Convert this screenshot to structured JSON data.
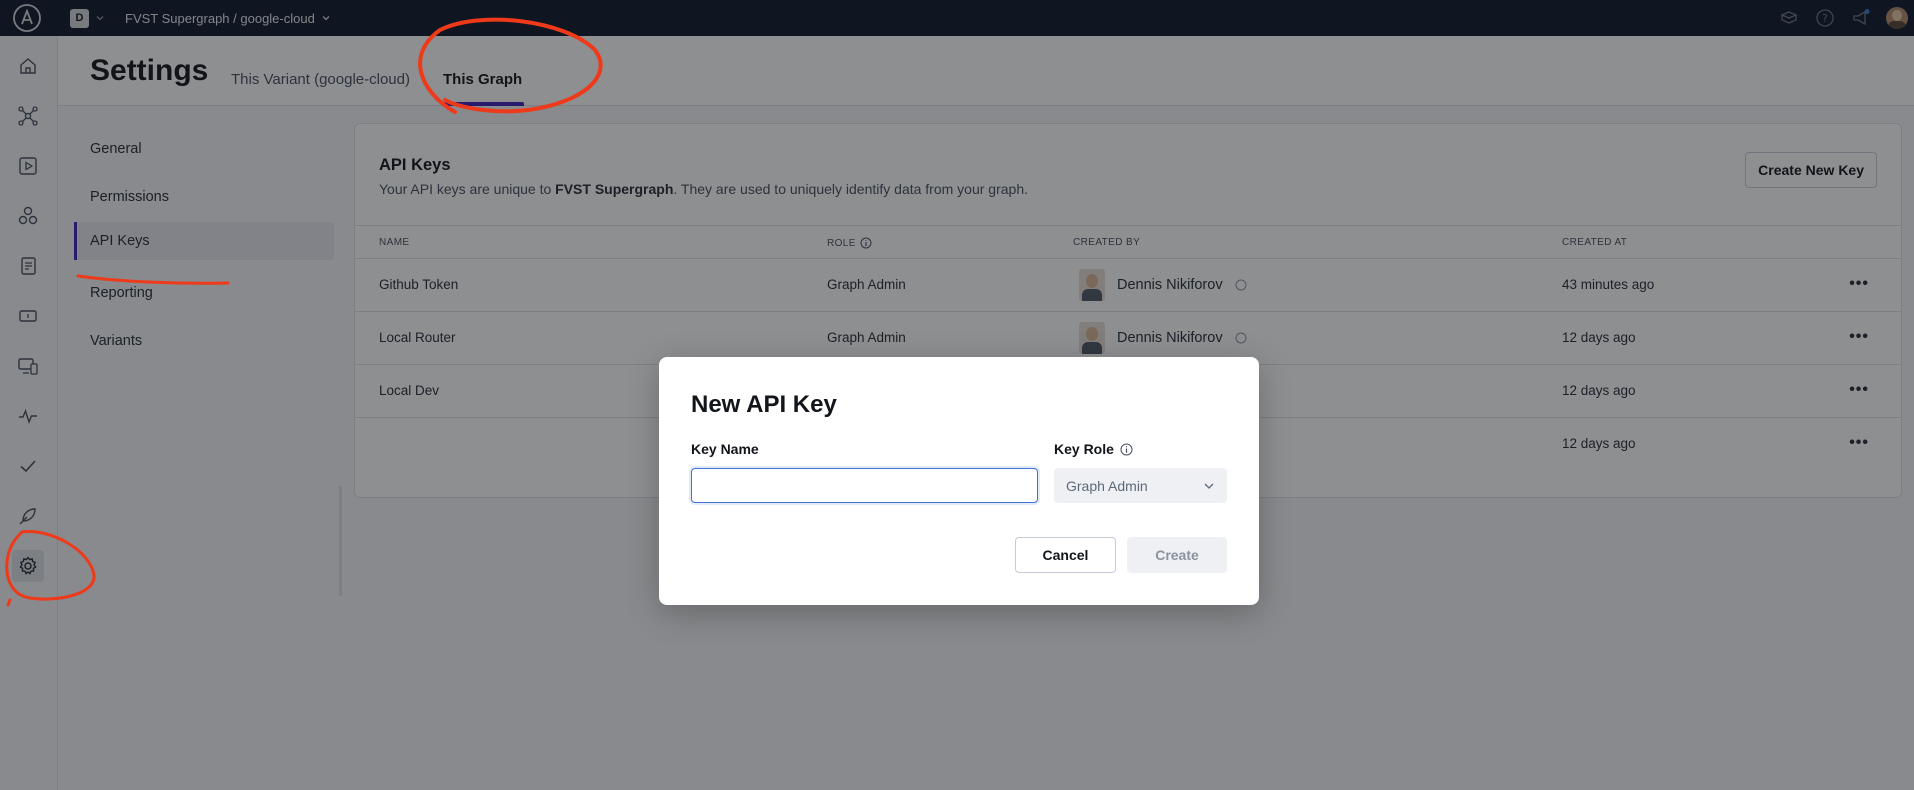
{
  "topbar": {
    "org_initial": "D",
    "graph_title": "FVST Supergraph / google-cloud"
  },
  "header": {
    "page_title": "Settings",
    "tabs": [
      {
        "label": "This Variant (google-cloud)"
      },
      {
        "label": "This Graph"
      }
    ]
  },
  "subnav": {
    "items": [
      {
        "label": "General"
      },
      {
        "label": "Permissions"
      },
      {
        "label": "API Keys"
      },
      {
        "label": "Reporting"
      },
      {
        "label": "Variants"
      }
    ]
  },
  "api_keys": {
    "title": "API Keys",
    "desc_prefix": "Your API keys are unique to ",
    "desc_graph": "FVST Supergraph",
    "desc_suffix": ". They are used to uniquely identify data from your graph.",
    "create_button": "Create New Key",
    "columns": {
      "name": "NAME",
      "role": "ROLE",
      "created_by": "CREATED BY",
      "created_at": "CREATED AT"
    },
    "rows": [
      {
        "name": "Github Token",
        "role": "Graph Admin",
        "created_by": "Dennis Nikiforov",
        "created_at": "43 minutes ago"
      },
      {
        "name": "Local Router",
        "role": "Graph Admin",
        "created_by": "Dennis Nikiforov",
        "created_at": "12 days ago"
      },
      {
        "name": "Local Dev",
        "role": "",
        "created_by": "",
        "created_at": "12 days ago"
      },
      {
        "name": "",
        "role": "",
        "created_by": "",
        "created_at": "12 days ago"
      }
    ],
    "more": "•••"
  },
  "modal": {
    "title": "New API Key",
    "key_name_label": "Key Name",
    "key_name_value": "",
    "key_role_label": "Key Role",
    "key_role_value": "Graph Admin",
    "cancel": "Cancel",
    "create": "Create"
  },
  "colors": {
    "topbar": "#0f172a",
    "accent": "#3f20ba",
    "annotation": "#ee3a1a"
  },
  "icons": [
    "apollo-logo-icon",
    "home-icon",
    "schema-graph-icon",
    "explorer-play-icon",
    "subgraphs-icon",
    "changelog-icon",
    "operations-icon",
    "clients-icon",
    "insights-icon",
    "checks-icon",
    "launches-icon",
    "settings-gear-icon",
    "docs-icon",
    "help-icon",
    "announcements-icon",
    "info-icon",
    "github-icon",
    "chevron-down-icon"
  ]
}
